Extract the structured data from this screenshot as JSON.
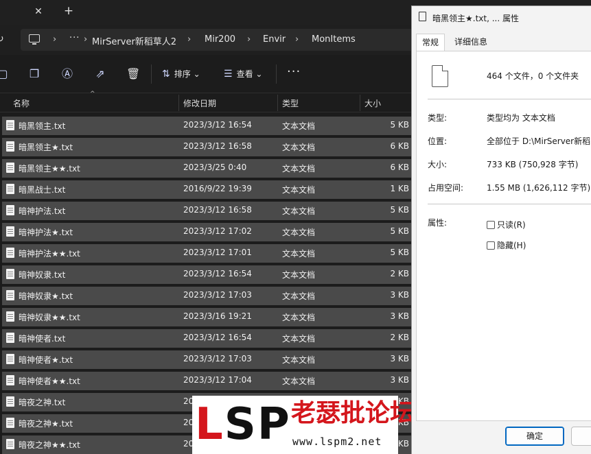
{
  "tabstrip": {
    "close_glyph": "✕",
    "new_tab_glyph": "+"
  },
  "address_bar": {
    "more_glyph": "···",
    "crumbs": [
      "MirServer新稻草人2",
      "Mir200",
      "Envir",
      "MonItems"
    ],
    "separator": "›"
  },
  "commandbar": {
    "icons": [
      "copy-icon",
      "paste-icon",
      "rename-icon",
      "share-icon",
      "delete-icon"
    ],
    "sort_label": "排序",
    "view_label": "查看",
    "more_glyph": "···"
  },
  "list": {
    "columns": {
      "name": "名称",
      "date": "修改日期",
      "type": "类型",
      "size": "大小"
    },
    "rows": [
      {
        "name": "暗黑领主.txt",
        "date": "2023/3/12 16:54",
        "type": "文本文档",
        "size": "5 KB"
      },
      {
        "name": "暗黑领主★.txt",
        "date": "2023/3/12 16:58",
        "type": "文本文档",
        "size": "6 KB"
      },
      {
        "name": "暗黑领主★★.txt",
        "date": "2023/3/25 0:40",
        "type": "文本文档",
        "size": "6 KB"
      },
      {
        "name": "暗黑战士.txt",
        "date": "2016/9/22 19:39",
        "type": "文本文档",
        "size": "1 KB"
      },
      {
        "name": "暗神护法.txt",
        "date": "2023/3/12 16:58",
        "type": "文本文档",
        "size": "5 KB"
      },
      {
        "name": "暗神护法★.txt",
        "date": "2023/3/12 17:02",
        "type": "文本文档",
        "size": "5 KB"
      },
      {
        "name": "暗神护法★★.txt",
        "date": "2023/3/12 17:01",
        "type": "文本文档",
        "size": "5 KB"
      },
      {
        "name": "暗神奴隶.txt",
        "date": "2023/3/12 16:54",
        "type": "文本文档",
        "size": "2 KB"
      },
      {
        "name": "暗神奴隶★.txt",
        "date": "2023/3/12 17:03",
        "type": "文本文档",
        "size": "3 KB"
      },
      {
        "name": "暗神奴隶★★.txt",
        "date": "2023/3/16 19:21",
        "type": "文本文档",
        "size": "3 KB"
      },
      {
        "name": "暗神使者.txt",
        "date": "2023/3/12 16:54",
        "type": "文本文档",
        "size": "2 KB"
      },
      {
        "name": "暗神使者★.txt",
        "date": "2023/3/12 17:03",
        "type": "文本文档",
        "size": "3 KB"
      },
      {
        "name": "暗神使者★★.txt",
        "date": "2023/3/12 17:04",
        "type": "文本文档",
        "size": "3 KB"
      },
      {
        "name": "暗夜之神.txt",
        "date": "20",
        "type": "",
        "size": "KB"
      },
      {
        "name": "暗夜之神★.txt",
        "date": "20",
        "type": "",
        "size": "KB"
      },
      {
        "name": "暗夜之神★★.txt",
        "date": "20",
        "type": "",
        "size": "KB"
      }
    ]
  },
  "watermark": {
    "logo": "LSP",
    "site_name": "老瑟批论坛",
    "url": "www.lspm2.net"
  },
  "dialog": {
    "title": "暗黑领主★.txt, ... 属性",
    "tabs": {
      "general": "常规",
      "details": "详细信息"
    },
    "summary": "464 个文件，0 个文件夹",
    "type_label": "类型:",
    "type_value": "类型均为 文本文档",
    "location_label": "位置:",
    "location_value": "全部位于 D:\\MirServer新稻",
    "size_label": "大小:",
    "size_value": "733 KB (750,928 字节)",
    "disk_label": "占用空间:",
    "disk_value": "1.55 MB (1,626,112 字节)",
    "attr_label": "属性:",
    "readonly_label": "只读(R)",
    "hidden_label": "隐藏(H)",
    "ok_label": "确定"
  }
}
